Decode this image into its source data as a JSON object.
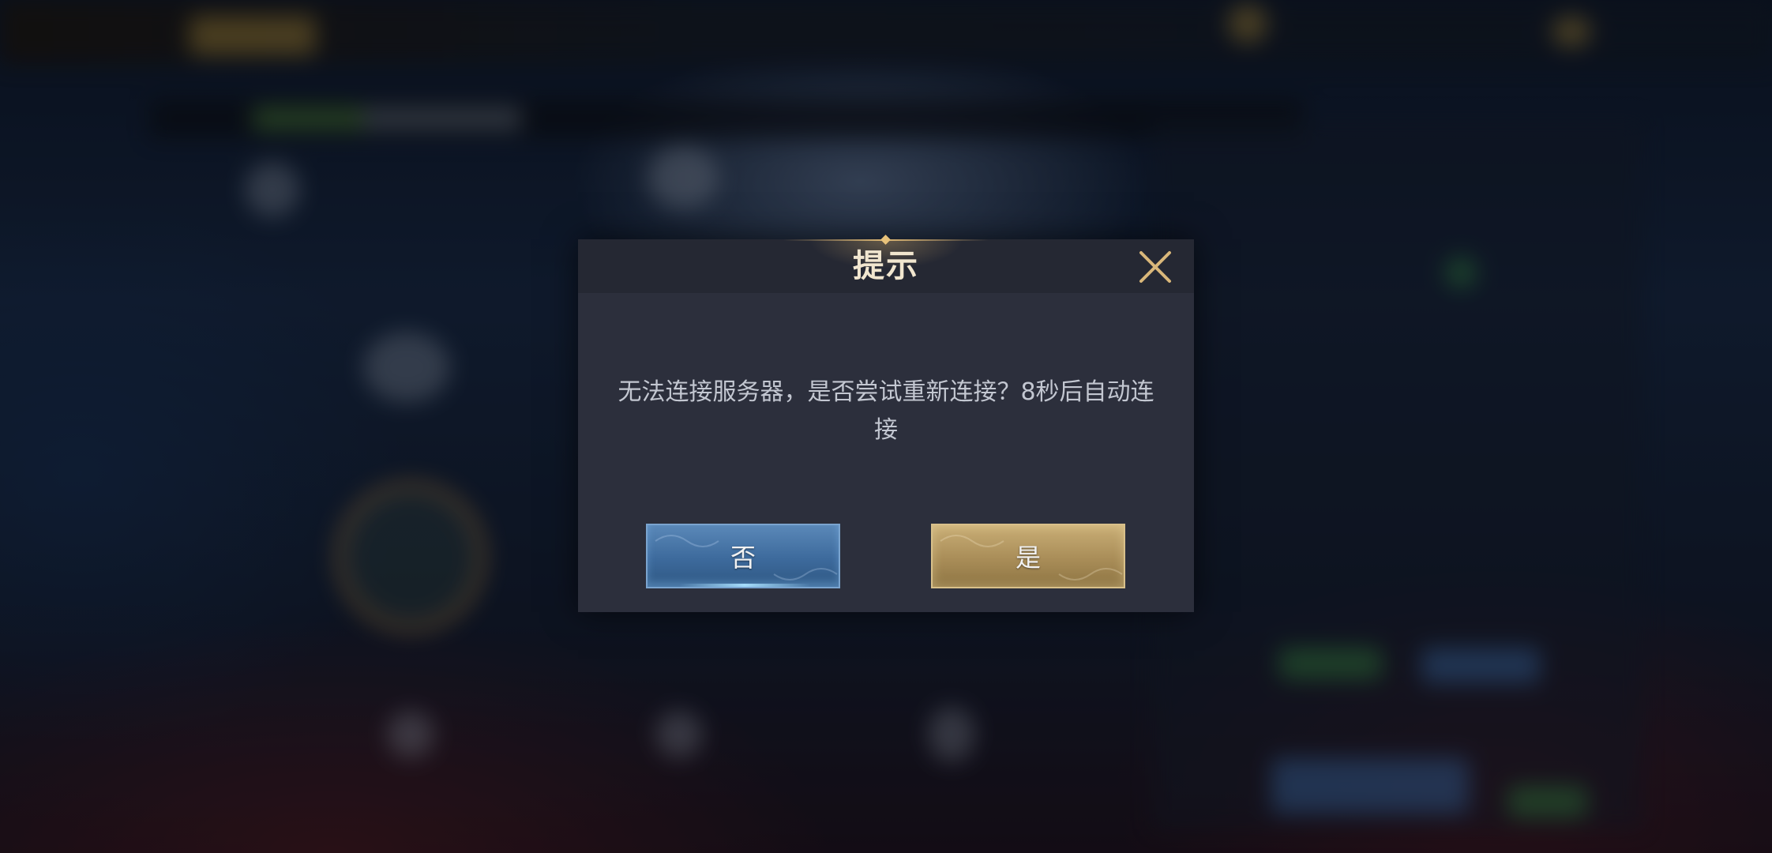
{
  "dialog": {
    "title": "提示",
    "message": "无法连接服务器，是否尝试重新连接？8秒后自动连接",
    "no_label": "否",
    "yes_label": "是",
    "close_icon": "close-icon"
  },
  "colors": {
    "dialog_bg": "#2c2f3c",
    "header_bg": "#252833",
    "title": "#f1e6cf",
    "close_icon": "#d9b77a",
    "message": "#c3c7d1",
    "no_button": "#3d6a9c",
    "yes_button": "#a98d58"
  }
}
